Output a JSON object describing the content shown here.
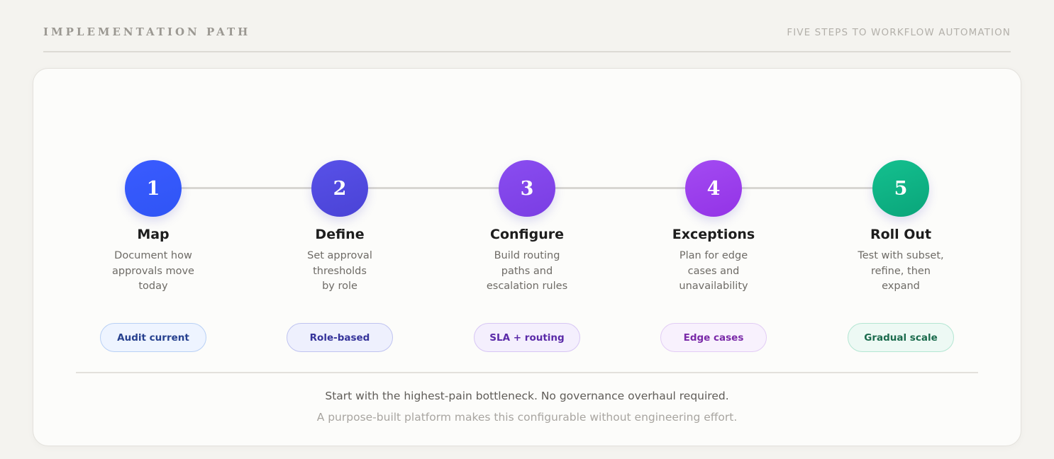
{
  "header": {
    "eyebrow": "IMPLEMENTATION PATH",
    "tagline": "FIVE STEPS TO WORKFLOW AUTOMATION"
  },
  "steps": [
    {
      "number": "1",
      "title": "Map",
      "description": "Document how\napprovals move\ntoday",
      "tag": "Audit current",
      "color_start": "#3a5bff",
      "color_end": "#2f55f5",
      "tag_bg": "#eef4ff",
      "tag_border": "#b8d0f5",
      "tag_text": "#27418f"
    },
    {
      "number": "2",
      "title": "Define",
      "description": "Set approval\nthresholds\nby role",
      "tag": "Role-based",
      "color_start": "#5851e8",
      "color_end": "#4a43d6",
      "tag_bg": "#eef0fd",
      "tag_border": "#bfc3f0",
      "tag_text": "#35339a"
    },
    {
      "number": "3",
      "title": "Configure",
      "description": "Build routing\npaths and\nescalation rules",
      "tag": "SLA + routing",
      "color_start": "#8a4df0",
      "color_end": "#7a3de3",
      "tag_bg": "#f4effd",
      "tag_border": "#d7c6f4",
      "tag_text": "#5a2aa8"
    },
    {
      "number": "4",
      "title": "Exceptions",
      "description": "Plan for edge\ncases and\nunavailability",
      "tag": "Edge cases",
      "color_start": "#a34bf2",
      "color_end": "#9333e6",
      "tag_bg": "#f8f1fd",
      "tag_border": "#e2ccf5",
      "tag_text": "#7a2aa8"
    },
    {
      "number": "5",
      "title": "Roll Out",
      "description": "Test with subset,\nrefine, then\nexpand",
      "tag": "Gradual scale",
      "color_start": "#14c08f",
      "color_end": "#0aa57a",
      "tag_bg": "#edf9f4",
      "tag_border": "#b3e6d2",
      "tag_text": "#1b6b4d"
    }
  ],
  "footer": {
    "main": "Start with the highest-pain bottleneck. No governance overhaul required.",
    "sub": "A purpose-built platform makes this configurable without engineering effort."
  }
}
